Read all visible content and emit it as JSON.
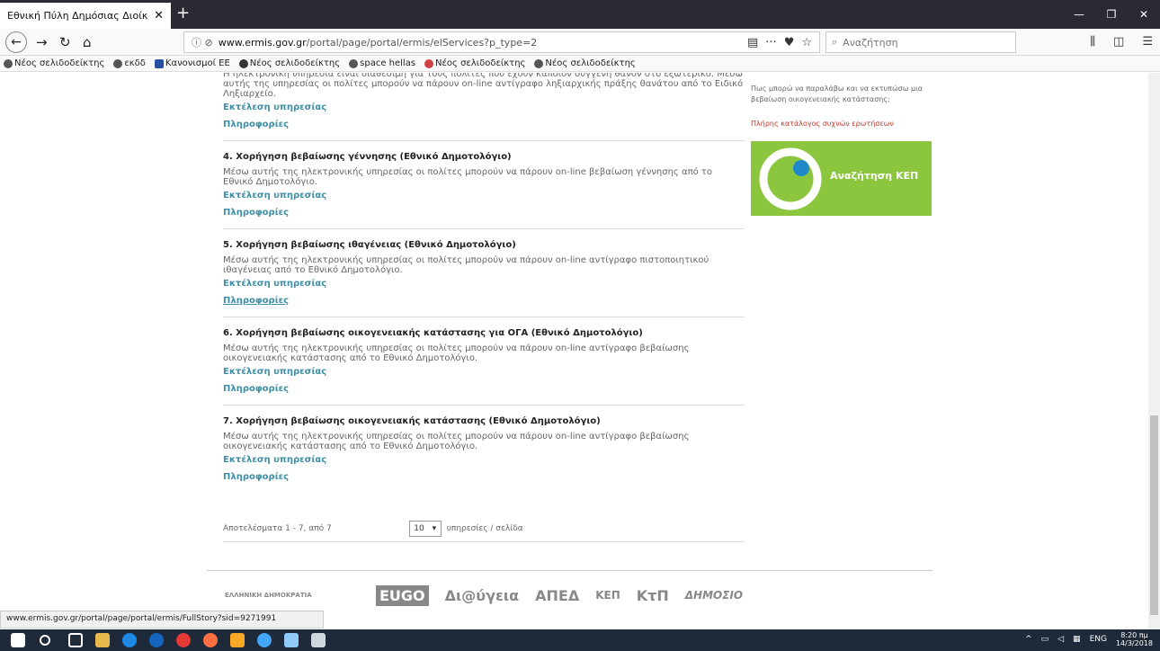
{
  "browser": {
    "tab_title": "Εθνική Πύλη Δημόσιας Διοίκησης",
    "url_host": "www.ermis.gov.gr",
    "url_path": "/portal/page/portal/ermis/elServices?p_type=2",
    "url_prefix_icons": "ⓘ ⊘",
    "search_placeholder": "Αναζήτηση"
  },
  "bookmarks": [
    "Νέος σελιδοδείκτης",
    "εκδδ",
    "Κανονισμοί ΕΕ",
    "Νέος σελιδοδείκτης",
    "space hellas",
    "Νέος σελιδοδείκτης",
    "Νέος σελιδοδείκτης"
  ],
  "partial": {
    "text": "Η ηλεκτρονική υπηρεσία είναι διαθέσιμη για τους πολίτες που έχουν κάποιον συγγενή θανόν στο εξωτερικό. Μέσω αυτής της υπηρεσίας οι πολίτες μπορούν να πάρουν on-line αντίγραφο ληξιαρχικής πράξης θανάτου από το Ειδικό Ληξιαρχείο.",
    "run": "Εκτέλεση υπηρεσίας",
    "info": "Πληροφορίες"
  },
  "services": [
    {
      "title": "4. Χορήγηση βεβαίωσης γέννησης (Εθνικό Δημοτολόγιο)",
      "desc": "Μέσω αυτής της ηλεκτρονικής υπηρεσίας οι πολίτες μπορούν να πάρουν on-line βεβαίωση γέννησης από το Εθνικό Δημοτολόγιο.",
      "run": "Εκτέλεση υπηρεσίας",
      "info": "Πληροφορίες"
    },
    {
      "title": "5. Χορήγηση βεβαίωσης ιθαγένειας (Εθνικό Δημοτολόγιο)",
      "desc": "Μέσω αυτής της ηλεκτρονικής υπηρεσίας οι πολίτες μπορούν να πάρουν on-line αντίγραφο πιστοποιητικού ιθαγένειας από το Εθνικό Δημοτολόγιο.",
      "run": "Εκτέλεση υπηρεσίας",
      "info": "Πληροφορίες"
    },
    {
      "title": "6. Χορήγηση βεβαίωσης οικογενειακής κατάστασης για ΟΓΑ (Εθνικό Δημοτολόγιο)",
      "desc": "Μέσω αυτής της ηλεκτρονικής υπηρεσίας οι πολίτες μπορούν να πάρουν on-line αντίγραφο βεβαίωσης οικογενειακής κατάστασης από το Εθνικό Δημοτολόγιο.",
      "run": "Εκτέλεση υπηρεσίας",
      "info": "Πληροφορίες"
    },
    {
      "title": "7. Χορήγηση βεβαίωσης οικογενειακής κατάστασης (Εθνικό Δημοτολόγιο)",
      "desc": "Μέσω αυτής της ηλεκτρονικής υπηρεσίας οι πολίτες μπορούν να πάρουν on-line αντίγραφο βεβαίωσης οικογενειακής κατάστασης από το Εθνικό Δημοτολόγιο.",
      "run": "Εκτέλεση υπηρεσίας",
      "info": "Πληροφορίες"
    }
  ],
  "pager": {
    "results": "Αποτελέσματα 1 - 7, από 7",
    "per_page": "10",
    "per_page_label": "υπηρεσίες / σελίδα"
  },
  "sidebar": {
    "faq_question": "Πως μπορώ να παραλάβω και να εκτυπώσω μια βεβαίωση οικογενειακής κατάστασης;",
    "faq_link": "Πλήρης κατάλογος συχνών ερωτήσεων",
    "kep_label": "Αναζήτηση ΚΕΠ"
  },
  "footer_logos": [
    "ΕΛΛΗΝΙΚΗ ΔΗΜΟΚΡΑΤΙΑ",
    "EUGO",
    "Δι@ύγεια",
    "ΑΠΕΔ",
    "ΚΕΠ",
    "ΚτΠ",
    "ΔΗΜΟΣΙΟ"
  ],
  "status_url": "www.ermis.gov.gr/portal/page/portal/ermis/FullStory?sid=9271991",
  "taskbar": {
    "lang": "ENG",
    "time": "8:20 πμ",
    "date": "14/3/2018"
  },
  "colors": {
    "link": "#3f8fa6",
    "kep": "#8cc63f",
    "faq": "#c0392b"
  }
}
